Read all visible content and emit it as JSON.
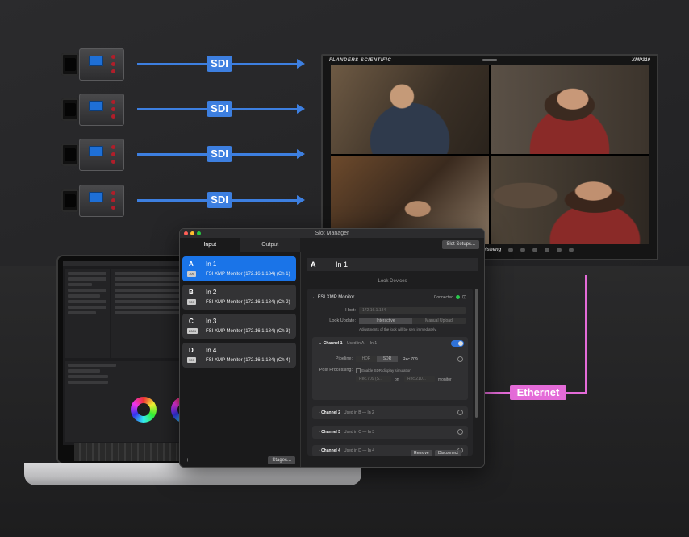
{
  "diagram": {
    "sdi_label": "SDI",
    "ethernet_label": "Ethernet",
    "colors": {
      "sdi_arrow": "#3d7fe0",
      "ethernet": "#e46bd8"
    }
  },
  "monitor": {
    "brand": "FLANDERS SCIENTIFIC",
    "model": "XMP310",
    "bottom_brand": "ruisheng"
  },
  "window": {
    "title": "Slot Manager",
    "tabs": [
      "Input",
      "Output"
    ],
    "slot_setups_button": "Slot Setups...",
    "stages_button": "Stages...",
    "slots": [
      {
        "letter": "A",
        "name": "In 1",
        "badge": "709",
        "device": "FSI XMP Monitor (172.16.1.184) (Ch 1)"
      },
      {
        "letter": "B",
        "name": "In 2",
        "badge": "709",
        "device": "FSI XMP Monitor (172.16.1.184) (Ch 2)"
      },
      {
        "letter": "C",
        "name": "In 3",
        "badge": "2084",
        "device": "FSI XMP Monitor (172.16.1.184) (Ch 3)"
      },
      {
        "letter": "D",
        "name": "In 4",
        "badge": "709",
        "device": "FSI XMP Monitor (172.16.1.184) (Ch 4)"
      }
    ],
    "detail": {
      "letter": "A",
      "name": "In 1",
      "look_devices_heading": "Look Devices",
      "device_name": "FSI XMP Monitor",
      "status": "Connected",
      "host_label": "Host:",
      "host_value": "172.16.1.184",
      "look_update_label": "Look Update:",
      "look_update_options": [
        "Interactive",
        "Manual Upload"
      ],
      "look_update_note": "Adjustments of the look will be sent immediately.",
      "channel1": {
        "title": "Channel 1",
        "used_in": "Used in A — In 1",
        "pipeline_label": "Pipeline:",
        "pipeline_options": [
          "HDR",
          "SDR"
        ],
        "pipeline_value": "Rec.709",
        "post_processing_label": "Post Processing:",
        "post_processing_checkbox": "Enable SDR display simulation",
        "post_processing_from": "Rec.709 (S...",
        "post_processing_on": "on",
        "post_processing_to": "Rec.210...",
        "post_processing_suffix": "monitor"
      },
      "channels": [
        {
          "title": "Channel 2",
          "used_in": "Used in B — In 2"
        },
        {
          "title": "Channel 3",
          "used_in": "Used in C — In 3"
        },
        {
          "title": "Channel 4",
          "used_in": "Used in D — In 4"
        }
      ],
      "remove_button": "Remove",
      "disconnect_button": "Disconnect"
    }
  }
}
